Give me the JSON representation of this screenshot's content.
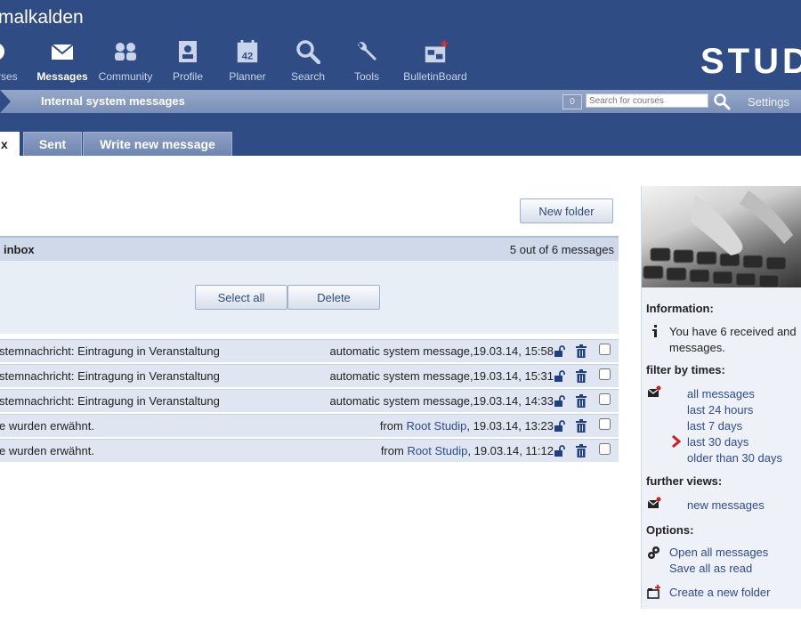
{
  "header": {
    "site_title": "malkalden",
    "logo_text": "STUD",
    "nav": [
      {
        "label": "urses",
        "icon": "courses-icon"
      },
      {
        "label": "Messages",
        "icon": "envelope-icon",
        "active": true
      },
      {
        "label": "Community",
        "icon": "community-icon"
      },
      {
        "label": "Profile",
        "icon": "profile-icon"
      },
      {
        "label": "Planner",
        "icon": "calendar-icon",
        "badge": "42"
      },
      {
        "label": "Search",
        "icon": "search-icon"
      },
      {
        "label": "Tools",
        "icon": "wrench-icon"
      },
      {
        "label": "BulletinBoard",
        "icon": "bulletin-board-icon"
      }
    ]
  },
  "subbar": {
    "title": "Internal system messages",
    "counter": "0",
    "search_placeholder": "Search for courses",
    "settings": "Settings"
  },
  "tabs": [
    {
      "label": "x",
      "active": true
    },
    {
      "label": "Sent"
    },
    {
      "label": "Write new message"
    }
  ],
  "main": {
    "new_folder": "New folder",
    "inbox_title": "inbox",
    "inbox_count": "5 out of 6 messages",
    "select_all": "Select all",
    "delete": "Delete"
  },
  "messages": [
    {
      "subject": "stemnachricht: Eintragung in Veranstaltung",
      "prefix": "automatic system message,",
      "sender": "",
      "time": "19.03.14, 15:58"
    },
    {
      "subject": "stemnachricht: Eintragung in Veranstaltung",
      "prefix": "automatic system message,",
      "sender": "",
      "time": "19.03.14, 15:31"
    },
    {
      "subject": "stemnachricht: Eintragung in Veranstaltung",
      "prefix": "automatic system message,",
      "sender": "",
      "time": "19.03.14, 14:33"
    },
    {
      "subject": "e wurden erwähnt.",
      "prefix": "from ",
      "sender": "Root Studip",
      "time": ", 19.03.14, 13:23"
    },
    {
      "subject": "e wurden erwähnt.",
      "prefix": "from ",
      "sender": "Root Studip",
      "time": ", 19.03.14, 11:12"
    }
  ],
  "sidebar": {
    "information_heading": "Information:",
    "information_text": "You have 6 received and messages.",
    "filter_heading": "filter by times:",
    "filters": [
      "all messages",
      "last 24 hours",
      "last 7 days",
      "last 30 days",
      "older than 30 days"
    ],
    "active_filter": "last 30 days",
    "views_heading": "further views:",
    "views": [
      "new messages"
    ],
    "options_heading": "Options:",
    "options": [
      "Open all messages",
      "Save all as read"
    ],
    "create_folder": "Create a new folder"
  },
  "colors": {
    "header_bg": "#2f4c85",
    "link": "#2f4a8e",
    "accent_red": "#cc1f1f"
  }
}
